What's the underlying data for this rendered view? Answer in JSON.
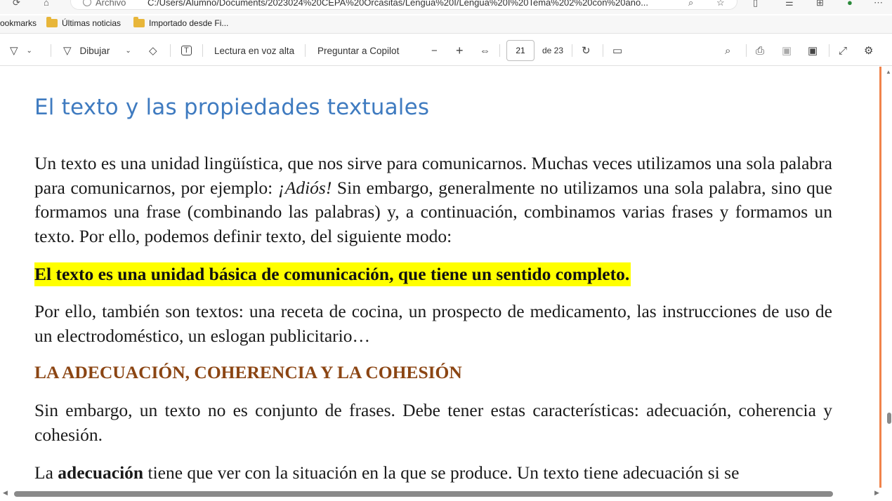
{
  "browser": {
    "address_prefix": "Archivo",
    "url": "C:/Users/Alumno/Documents/2023024%20CEPA%20Orcasitas/Lengua%20I/Lengua%20I%20Tema%202%20con%20ano...",
    "bookmarks_prefix": "ookmarks",
    "bookmarks": [
      {
        "label": "Últimas noticias"
      },
      {
        "label": "Importado desde Fi..."
      }
    ]
  },
  "toolbar": {
    "draw_label": "Dibujar",
    "read_aloud_label": "Lectura en voz alta",
    "copilot_label": "Preguntar a Copilot",
    "zoom_out": "−",
    "zoom_in": "+",
    "current_page": "21",
    "page_total": "de 23"
  },
  "document": {
    "title": "El texto y las propiedades textuales",
    "para1_part1": "Un texto es una unidad lingüística, que nos sirve para comunicarnos. Muchas veces utilizamos una sola palabra para comunicarnos, por ejemplo: ",
    "para1_italic": "¡Adiós!",
    "para1_part2": " Sin embargo, generalmente no utilizamos una sola palabra, sino que formamos una frase (combinando las palabras) y, a continuación, combinamos varias frases y formamos un texto. Por ello, podemos definir texto, del siguiente modo:",
    "definition": "El texto es una unidad básica de comunicación, que tiene un sentido completo.",
    "para2": "Por ello, también son textos: una receta de cocina, un prospecto de medicamento, las instrucciones de uso de un electrodoméstico, un eslogan publicitario…",
    "heading": "LA ADECUACIÓN, COHERENCIA Y LA COHESIÓN",
    "para3": "Sin embargo, un texto no es conjunto de frases. Debe tener estas características: adecuación, coherencia y cohesión.",
    "para4_part1": "La ",
    "para4_bold": "adecuación",
    "para4_part2": " tiene que ver con la situación en la que se produce. Un texto tiene adecuación si se"
  },
  "colors": {
    "title_blue": "#3f7bc0",
    "highlight_yellow": "#ffff00",
    "heading_brown": "#8b4513",
    "accent_orange": "#f0834a"
  }
}
